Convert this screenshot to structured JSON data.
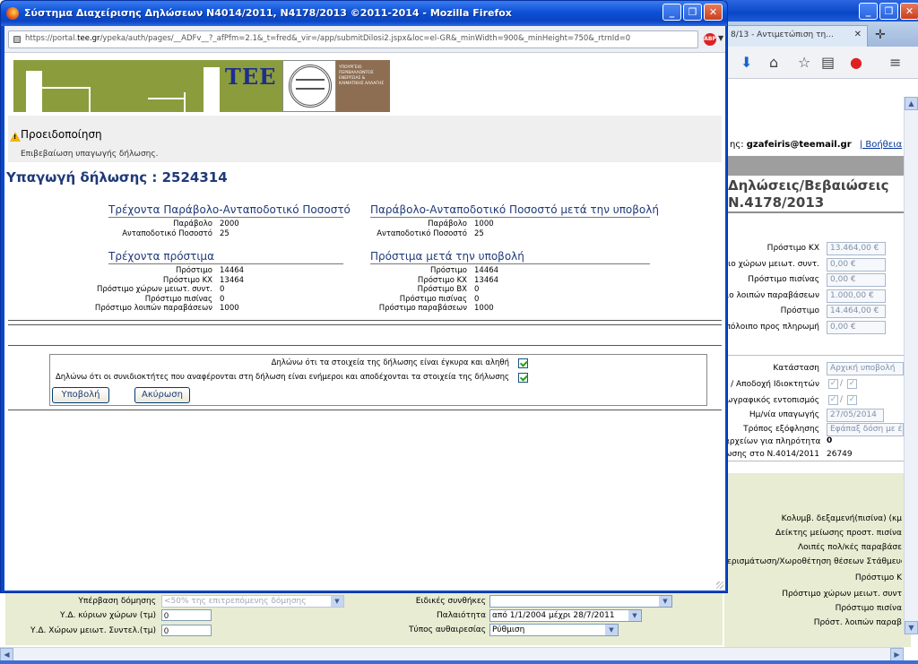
{
  "popup": {
    "title": "Σύστημα Διαχείρισης Δηλώσεων Ν4014/2011, Ν4178/2013 ©2011-2014 - Mozilla Firefox",
    "url_prefix": "https://portal.",
    "url_domain": "tee.gr",
    "url_rest": "/ypeka/auth/pages/__ADFv__?_afPfm=2.1&_t=fred&_vir=/app/submitDilosi2.jspx&loc=el-GR&_minWidth=900&_minHeight=750&_rtrnId=0",
    "abp_label": "ABP",
    "ministry_text": "ΥΠΟΥΡΓΕΙΟ ΠΕΡΙΒΑΛΛΟΝΤΟΣ ΕΝΕΡΓΕΙΑΣ & ΚΛΙΜΑΤΙΚΗΣ ΑΛΛΑΓΗΣ",
    "tee_logo": "ΤΕΕ",
    "warning": {
      "title": "Προειδοποίηση",
      "message": "Επιβεβαίωση υπαγωγής δήλωσης."
    },
    "submission_title": "Υπαγωγή δήλωσης : 2524314",
    "current_fee": {
      "title": "Τρέχοντα Παράβολο-Ανταποδοτικό Ποσοστό",
      "rows": [
        {
          "label": "Παράβολο",
          "value": "2000"
        },
        {
          "label": "Ανταποδοτικό Ποσοστό",
          "value": "25"
        }
      ]
    },
    "after_fee": {
      "title": "Παράβολο-Ανταποδοτικό Ποσοστό μετά την υποβολή",
      "rows": [
        {
          "label": "Παράβολο",
          "value": "1000"
        },
        {
          "label": "Ανταποδοτικό Ποσοστό",
          "value": "25"
        }
      ]
    },
    "current_fines": {
      "title": "Τρέχοντα πρόστιμα",
      "rows": [
        {
          "label": "Πρόστιμο",
          "value": "14464"
        },
        {
          "label": "Πρόστιμο ΚΧ",
          "value": "13464"
        },
        {
          "label": "Πρόστιμο χώρων μειωτ. συντ.",
          "value": "0"
        },
        {
          "label": "Πρόστιμο πισίνας",
          "value": "0"
        },
        {
          "label": "Πρόστιμο λοιπών παραβάσεων",
          "value": "1000"
        }
      ]
    },
    "after_fines": {
      "title": "Πρόστιμα μετά την υποβολή",
      "rows": [
        {
          "label": "Πρόστιμο",
          "value": "14464"
        },
        {
          "label": "Πρόστιμο ΚΧ",
          "value": "13464"
        },
        {
          "label": "Πρόστιμο ΒΧ",
          "value": "0"
        },
        {
          "label": "Πρόστιμο πισίνας",
          "value": "0"
        },
        {
          "label": "Πρόστιμο παραβάσεων",
          "value": "1000"
        }
      ]
    },
    "confirm_1": "Δηλώνω ότι τα στοιχεία της δήλωσης είναι έγκυρα και αληθή",
    "confirm_2": "Δηλώνω ότι οι συνιδιοκτήτες που αναφέρονται στη δήλωση είναι ενήμεροι και αποδέχονται τα στοιχεία της δήλωσης",
    "submit_label": "Υποβολή",
    "cancel_label": "Ακύρωση"
  },
  "background": {
    "tab_label": "8/13 - Αντιμετώπιση τη...",
    "user_label": "ης:",
    "user_email": "gzafeiris@teemail.gr",
    "help_label": "| Βοήθεια",
    "heading_line1": "Δηλώσεις/Βεβαιώσεις",
    "heading_line2": "Ν.4178/2013",
    "fines": [
      {
        "label": "Πρόστιμο ΚΧ",
        "value": "13.464,00 €"
      },
      {
        "label": "ιο χώρων μειωτ. συντ.",
        "value": "0,00 €"
      },
      {
        "label": "Πρόστιμο πισίνας",
        "value": "0,00 €"
      },
      {
        "label": "ιο λοιπών παραβάσεων",
        "value": "1.000,00 €"
      },
      {
        "label": "Πρόστιμο",
        "value": "14.464,00 €"
      },
      {
        "label": "πόλοιπο προς πληρωμή",
        "value": "0,00 €"
      }
    ],
    "status_label": "Κατάσταση",
    "status_value": "Αρχική υποβολή",
    "ownership_label": "/ Αποδοχή Ιδιοκτητών",
    "geo_label": "ωγραφικός εντοπισμός",
    "date_label": "Ημ/νία υπαγωγής",
    "date_value": "27/05/2014",
    "payment_label": "Τρόπος εξόφλησης",
    "payment_value": "Εφάπαξ δόση με έκ",
    "files_label": "αρχείων για πληρότητα",
    "files_value": "0",
    "n4014_label": "ωσης στο Ν.4014/2011",
    "n4014_value": "26749",
    "green_labels": [
      "Κολυμβ. δεξαμενή(πισίνα) (κμ",
      "Δείκτης μείωσης προστ. πισίνα",
      "Λοιπές πολ/κές παραβάσε",
      "ιερισμάτωση/Χωροθέτηση θέσεων Στάθμευση",
      "Πρόστιμο Κ",
      "Πρόστιμο χώρων μειωτ. συντ",
      "Πρόστιμο πισίνα",
      "Πρόστ. λοιπών παραβ"
    ],
    "bottom": {
      "over_build_label": "Υπέρβαση δόμησης",
      "over_build_value": "<50% της επιτρεπόμενης δόμησης",
      "main_area_label": "Υ.Δ. κύριων χώρων (τμ)",
      "main_area_value": "0",
      "reduced_area_label": "Υ.Δ. Χώρων μειωτ. Συντελ.(τμ)",
      "reduced_area_value": "0",
      "special_label": "Ειδικές συνθήκες",
      "special_value": "",
      "age_label": "Παλαιότητα",
      "age_value": "από 1/1/2004 μέχρι 28/7/2011",
      "type_label": "Τύπος αυθαιρεσίας",
      "type_value": "Ρύθμιση"
    }
  }
}
